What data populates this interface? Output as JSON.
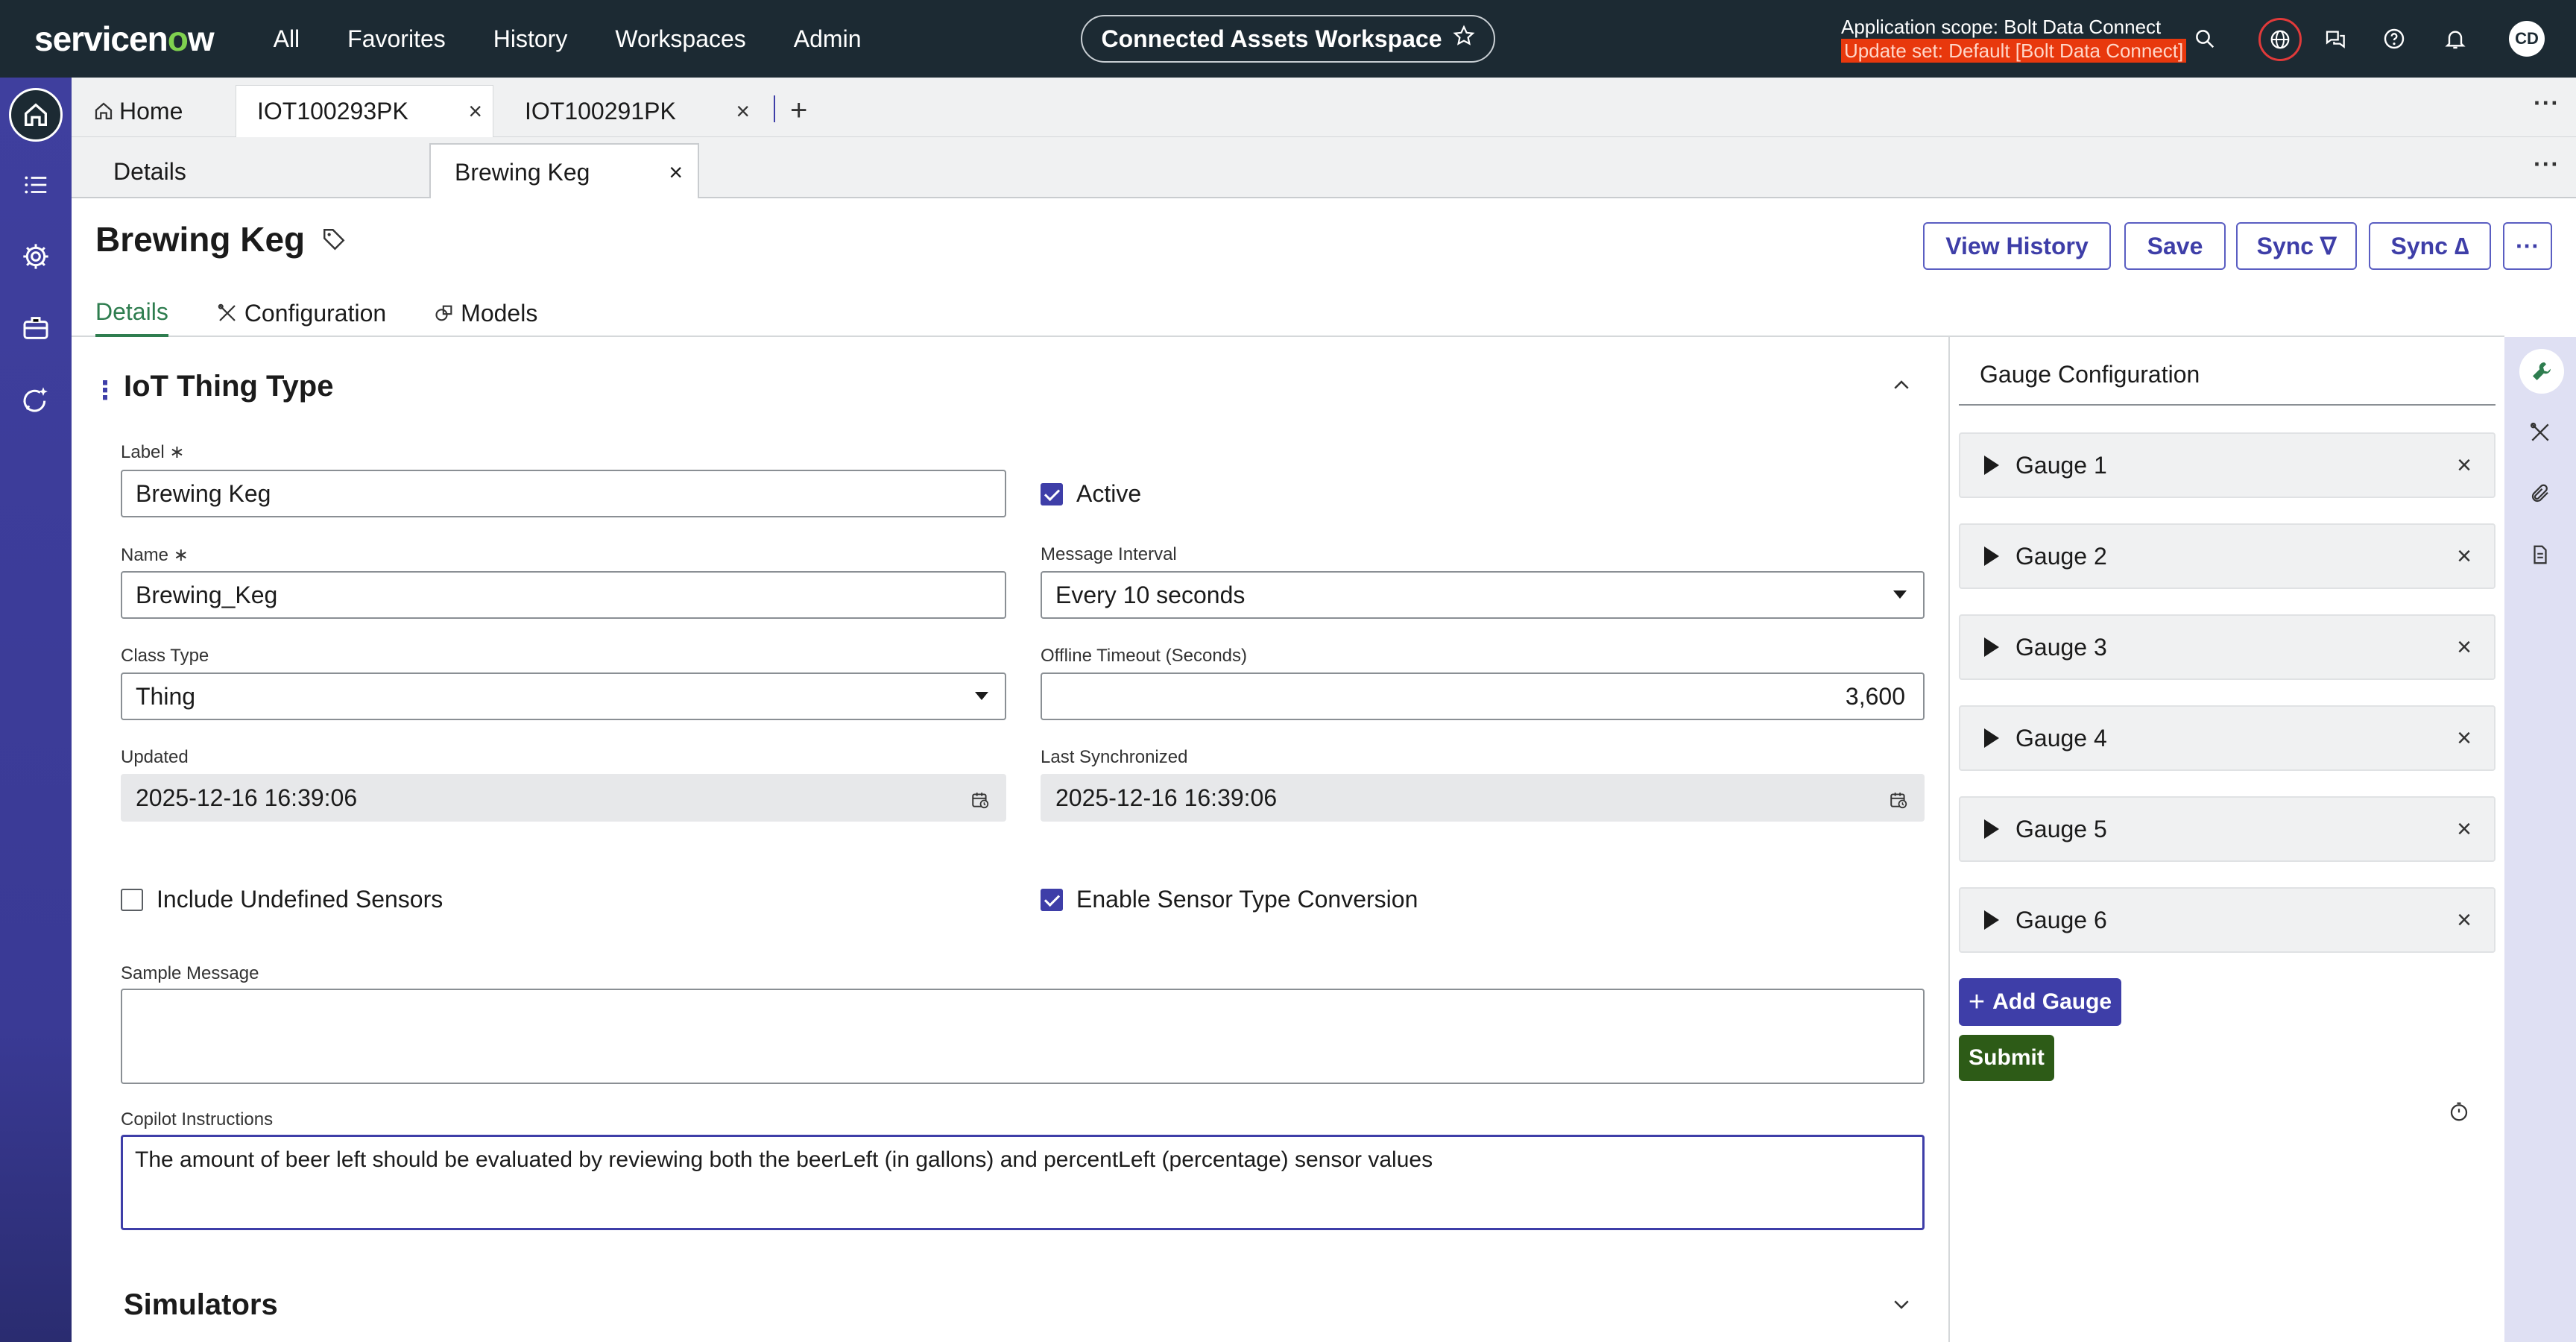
{
  "brand": {
    "logo_text_a": "servicen",
    "logo_text_o": "o",
    "logo_text_b": "w"
  },
  "topnav": {
    "items": [
      "All",
      "Favorites",
      "History",
      "Workspaces",
      "Admin"
    ]
  },
  "workspace": {
    "name": "Connected Assets Workspace"
  },
  "scope": {
    "app": "Application scope: Bolt Data Connect",
    "update_set": "Update set: Default [Bolt Data Connect]"
  },
  "user": {
    "initials": "CD"
  },
  "tabs": [
    {
      "label": "Home"
    },
    {
      "label": "IOT100293PK"
    },
    {
      "label": "IOT100291PK"
    }
  ],
  "subtabs": [
    {
      "label": "Details"
    },
    {
      "label": "Brewing Keg"
    }
  ],
  "record": {
    "title": "Brewing Keg"
  },
  "header_buttons": {
    "view_history": "View History",
    "save": "Save",
    "sync_down": "Sync ∇",
    "sync_up": "Sync ∆",
    "more": "···"
  },
  "content_tabs": [
    "Details",
    "Configuration",
    "Models"
  ],
  "section": {
    "title": "IoT Thing Type",
    "simulators": "Simulators"
  },
  "fields": {
    "label": {
      "label": "Label ∗",
      "value": "Brewing Keg"
    },
    "active": {
      "label": "Active",
      "checked": true
    },
    "name": {
      "label": "Name ∗",
      "value": "Brewing_Keg"
    },
    "message_interval": {
      "label": "Message Interval",
      "value": "Every 10 seconds"
    },
    "class_type": {
      "label": "Class Type",
      "value": "Thing"
    },
    "offline_timeout": {
      "label": "Offline Timeout (Seconds)",
      "value": "3,600"
    },
    "updated": {
      "label": "Updated",
      "value": "2025-12-16 16:39:06"
    },
    "last_synchronized": {
      "label": "Last Synchronized",
      "value": "2025-12-16 16:39:06"
    },
    "include_undefined": {
      "label": "Include Undefined Sensors",
      "checked": false
    },
    "enable_conversion": {
      "label": "Enable Sensor Type Conversion",
      "checked": true
    },
    "sample_message": {
      "label": "Sample Message",
      "value": ""
    },
    "copilot": {
      "label": "Copilot Instructions",
      "value": "The amount of beer left should be evaluated by reviewing both the beerLeft (in gallons) and percentLeft (percentage) sensor values"
    }
  },
  "gauge_panel": {
    "title": "Gauge Configuration",
    "gauges": [
      "Gauge 1",
      "Gauge 2",
      "Gauge 3",
      "Gauge 4",
      "Gauge 5",
      "Gauge 6"
    ],
    "add_label": "Add Gauge",
    "submit_label": "Submit"
  },
  "colors": {
    "accent": "#3e3ea8",
    "topbar": "#1c2a33",
    "success": "#2d5b17",
    "active_tab": "#2e7d4f"
  }
}
